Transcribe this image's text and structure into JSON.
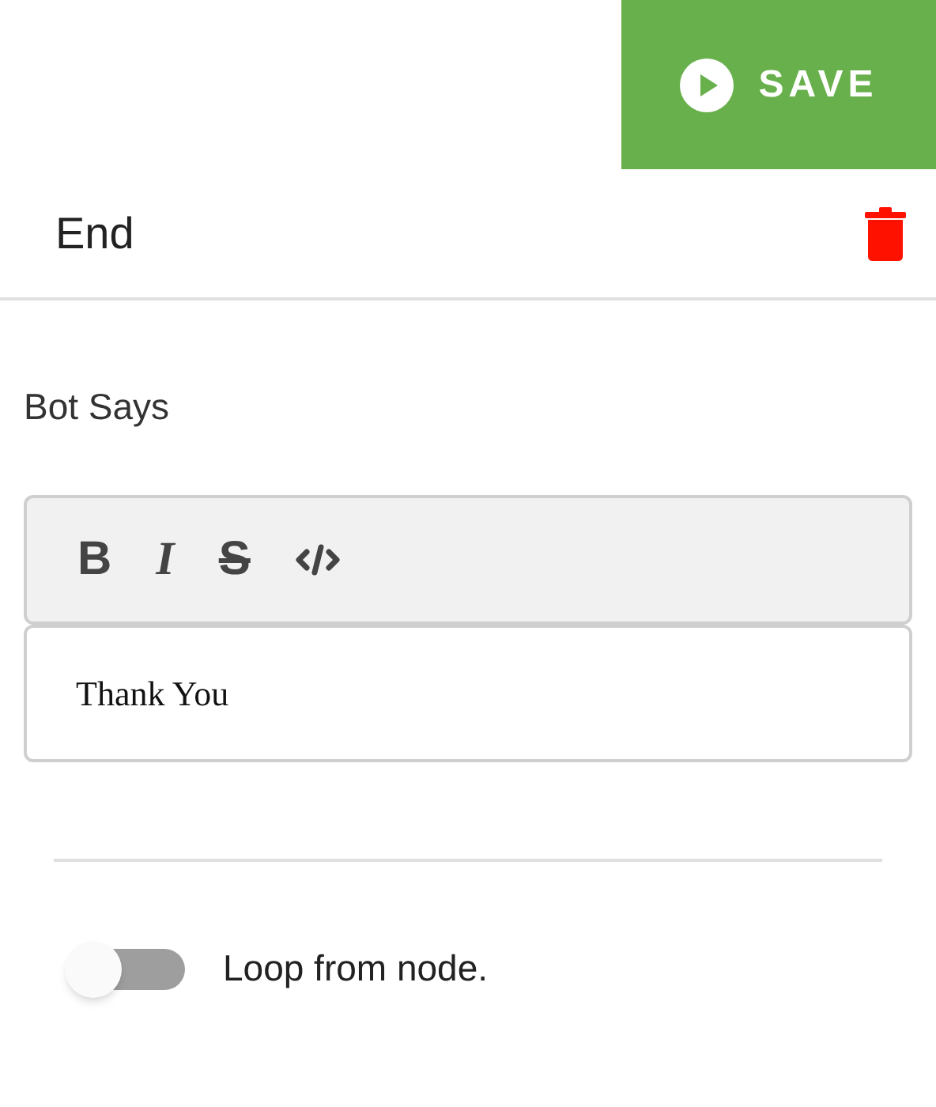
{
  "save_button": {
    "label": "SAVE"
  },
  "node": {
    "title": "End"
  },
  "bot_says": {
    "label": "Bot Says",
    "toolbar": [
      {
        "kind": "bold",
        "label": "B"
      },
      {
        "kind": "italic",
        "label": "I"
      },
      {
        "kind": "strike",
        "label": "S"
      },
      {
        "kind": "code"
      }
    ],
    "value": "Thank You"
  },
  "loop_toggle": {
    "label": "Loop from node.",
    "on": false
  }
}
